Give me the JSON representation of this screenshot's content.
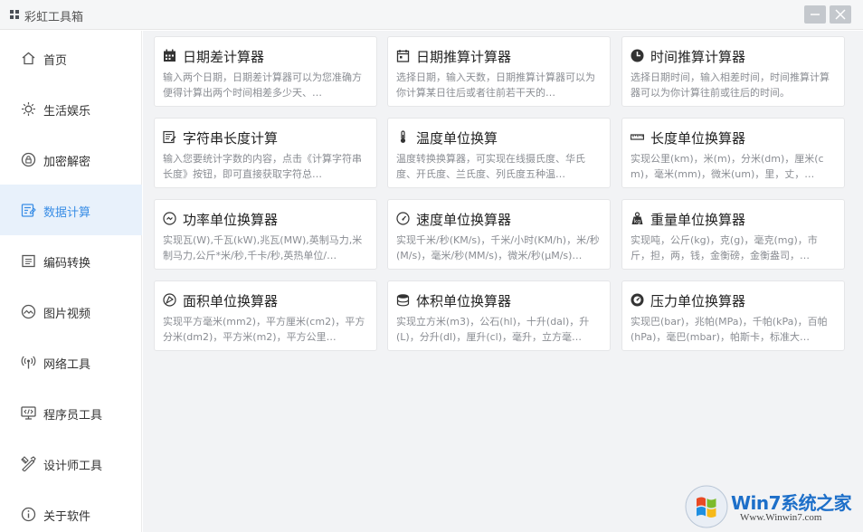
{
  "app": {
    "title": "彩虹工具箱"
  },
  "sidebar": {
    "items": [
      {
        "label": "首页",
        "icon": "home-icon",
        "active": false
      },
      {
        "label": "生活娱乐",
        "icon": "sun-icon",
        "active": false
      },
      {
        "label": "加密解密",
        "icon": "lock-icon",
        "active": false
      },
      {
        "label": "数据计算",
        "icon": "calculator-icon",
        "active": true
      },
      {
        "label": "编码转换",
        "icon": "code-icon",
        "active": false
      },
      {
        "label": "图片视频",
        "icon": "image-icon",
        "active": false
      },
      {
        "label": "网络工具",
        "icon": "network-icon",
        "active": false
      },
      {
        "label": "程序员工具",
        "icon": "monitor-code-icon",
        "active": false
      },
      {
        "label": "设计师工具",
        "icon": "design-tools-icon",
        "active": false
      },
      {
        "label": "关于软件",
        "icon": "info-icon",
        "active": false
      }
    ]
  },
  "cards": [
    {
      "title": "日期差计算器",
      "icon": "calendar-icon",
      "desc": "输入两个日期，日期差计算器可以为您准确方便得计算出两个时间相差多少天、…"
    },
    {
      "title": "日期推算计算器",
      "icon": "calendar-outline-icon",
      "desc": "选择日期，输入天数，日期推算计算器可以为你计算某日往后或者往前若干天的…"
    },
    {
      "title": "时间推算计算器",
      "icon": "clock-icon",
      "desc": "选择日期时间，输入相差时间，时间推算计算器可以为你计算往前或往后的时间。"
    },
    {
      "title": "字符串长度计算",
      "icon": "text-length-icon",
      "desc": "输入您要统计字数的内容，点击《计算字符串长度》按钮，即可直接获取字符总…"
    },
    {
      "title": "温度单位换算",
      "icon": "thermometer-icon",
      "desc": "温度转换换算器，可实现在线摄氏度、华氏度、开氏度、兰氏度、列氏度五种温…"
    },
    {
      "title": "长度单位换算器",
      "icon": "ruler-icon",
      "desc": "实现公里(km)，米(m)，分米(dm)，厘米(cm)，毫米(mm)，微米(um)，里，丈，…"
    },
    {
      "title": "功率单位换算器",
      "icon": "power-icon",
      "desc": "实现瓦(W),千瓦(kW),兆瓦(MW),英制马力,米制马力,公斤*米/秒,千卡/秒,英热单位/…"
    },
    {
      "title": "速度单位换算器",
      "icon": "speedometer-icon",
      "desc": "实现千米/秒(KM/s)，千米/小时(KM/h)，米/秒(M/s)，毫米/秒(MM/s)，微米/秒(μM/s)…"
    },
    {
      "title": "重量单位换算器",
      "icon": "weight-icon",
      "desc": "实现吨，公斤(kg)，克(g)，毫克(mg)，市斤，担，两，钱，金衡磅，金衡盎司，…"
    },
    {
      "title": "面积单位换算器",
      "icon": "area-icon",
      "desc": "实现平方毫米(mm2)，平方厘米(cm2)，平方分米(dm2)，平方米(m2)，平方公里…"
    },
    {
      "title": "体积单位换算器",
      "icon": "volume-icon",
      "desc": "实现立方米(m3)，公石(hl)，十升(dal)，升(L)，分升(dl)，厘升(cl)，毫升，立方毫…"
    },
    {
      "title": "压力单位换算器",
      "icon": "pressure-gauge-icon",
      "desc": "实现巴(bar)，兆帕(MPa)，千帕(kPa)，百帕(hPa)，毫巴(mbar)，帕斯卡，标准大…"
    }
  ],
  "watermark": {
    "brand": "Win7系统之家",
    "url": "Www.Winwin7.com"
  },
  "colors": {
    "accent": "#3a8ee6",
    "active_bg": "#e8f1fb",
    "main_bg": "#f2f3f5"
  }
}
